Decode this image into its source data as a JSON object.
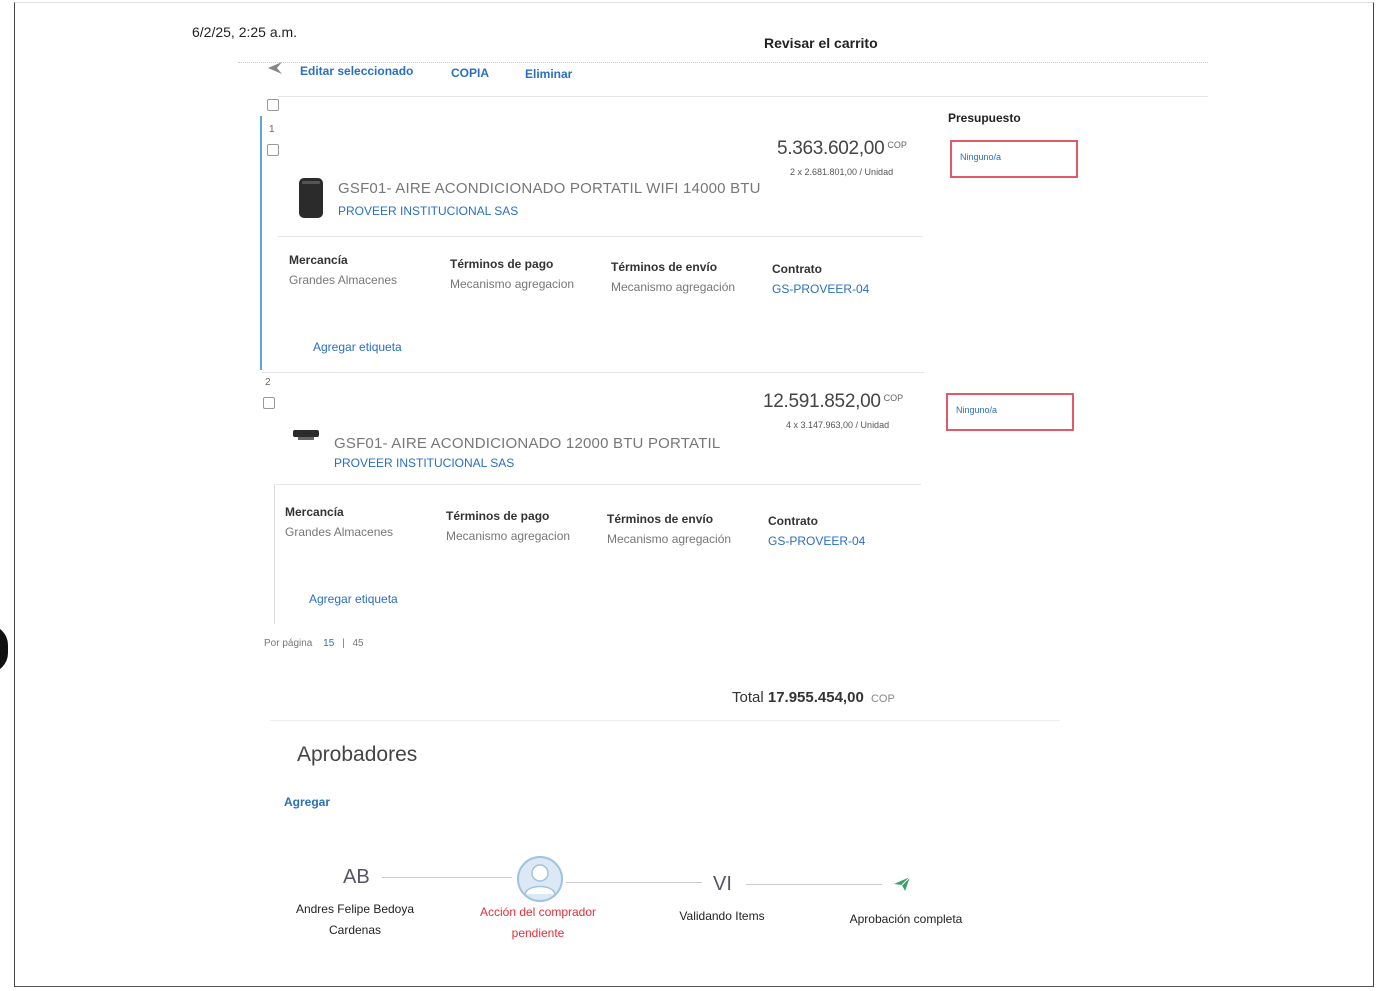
{
  "timestamp": "6/2/25, 2:25 a.m.",
  "page_title": "Revisar el carrito",
  "toolbar": {
    "edit_label": "Editar seleccionado",
    "copy_label": "COPIA",
    "delete_label": "Eliminar"
  },
  "budget_header": "Presupuesto",
  "field_labels": {
    "merchandise": "Mercancía",
    "payment": "Términos de pago",
    "shipping": "Términos de envío",
    "contract": "Contrato"
  },
  "add_tag_label": "Agregar etiqueta",
  "items": [
    {
      "number": "1",
      "price": "5.363.602,00",
      "currency": "COP",
      "unit_price": "2 x 2.681.801,00 / Unidad",
      "name": "GSF01- AIRE ACONDICIONADO PORTATIL WIFI 14000 BTU",
      "supplier": "PROVEER INSTITUCIONAL SAS",
      "merchandise": "Grandes Almacenes",
      "payment": "Mecanismo agregacion",
      "shipping": "Mecanismo agregación",
      "contract": "GS-PROVEER-04",
      "budget": "Ninguno/a"
    },
    {
      "number": "2",
      "price": "12.591.852,00",
      "currency": "COP",
      "unit_price": "4 x 3.147.963,00 / Unidad",
      "name": "GSF01- AIRE ACONDICIONADO 12000 BTU PORTATIL",
      "supplier": "PROVEER INSTITUCIONAL SAS",
      "merchandise": "Grandes Almacenes",
      "payment": "Mecanismo agregacion",
      "shipping": "Mecanismo agregación",
      "contract": "GS-PROVEER-04",
      "budget": "Ninguno/a"
    }
  ],
  "pagination": {
    "label": "Por página",
    "option_active": "15",
    "separator": "|",
    "option_other": "45"
  },
  "total": {
    "label": "Total",
    "amount": "17.955.454,00",
    "currency": "COP"
  },
  "approvers": {
    "title": "Aprobadores",
    "add_label": "Agregar",
    "steps": [
      {
        "initials": "AB",
        "name_line1": "Andres Felipe Bedoya",
        "name_line2": "Cardenas"
      },
      {
        "name_line1": "Acción del comprador",
        "name_line2": "pendiente",
        "status_color": "#e0303a"
      },
      {
        "initials": "VI",
        "name_line1": "Validando Items"
      },
      {
        "name_line1": "Aprobación completa",
        "icon": "paper-plane-icon"
      }
    ]
  },
  "colors": {
    "link": "#2a6fc0",
    "accent_line": "#5aa5e0",
    "budget_border": "#e05a6a",
    "pending": "#e0303a",
    "plane": "#3aa06a"
  }
}
